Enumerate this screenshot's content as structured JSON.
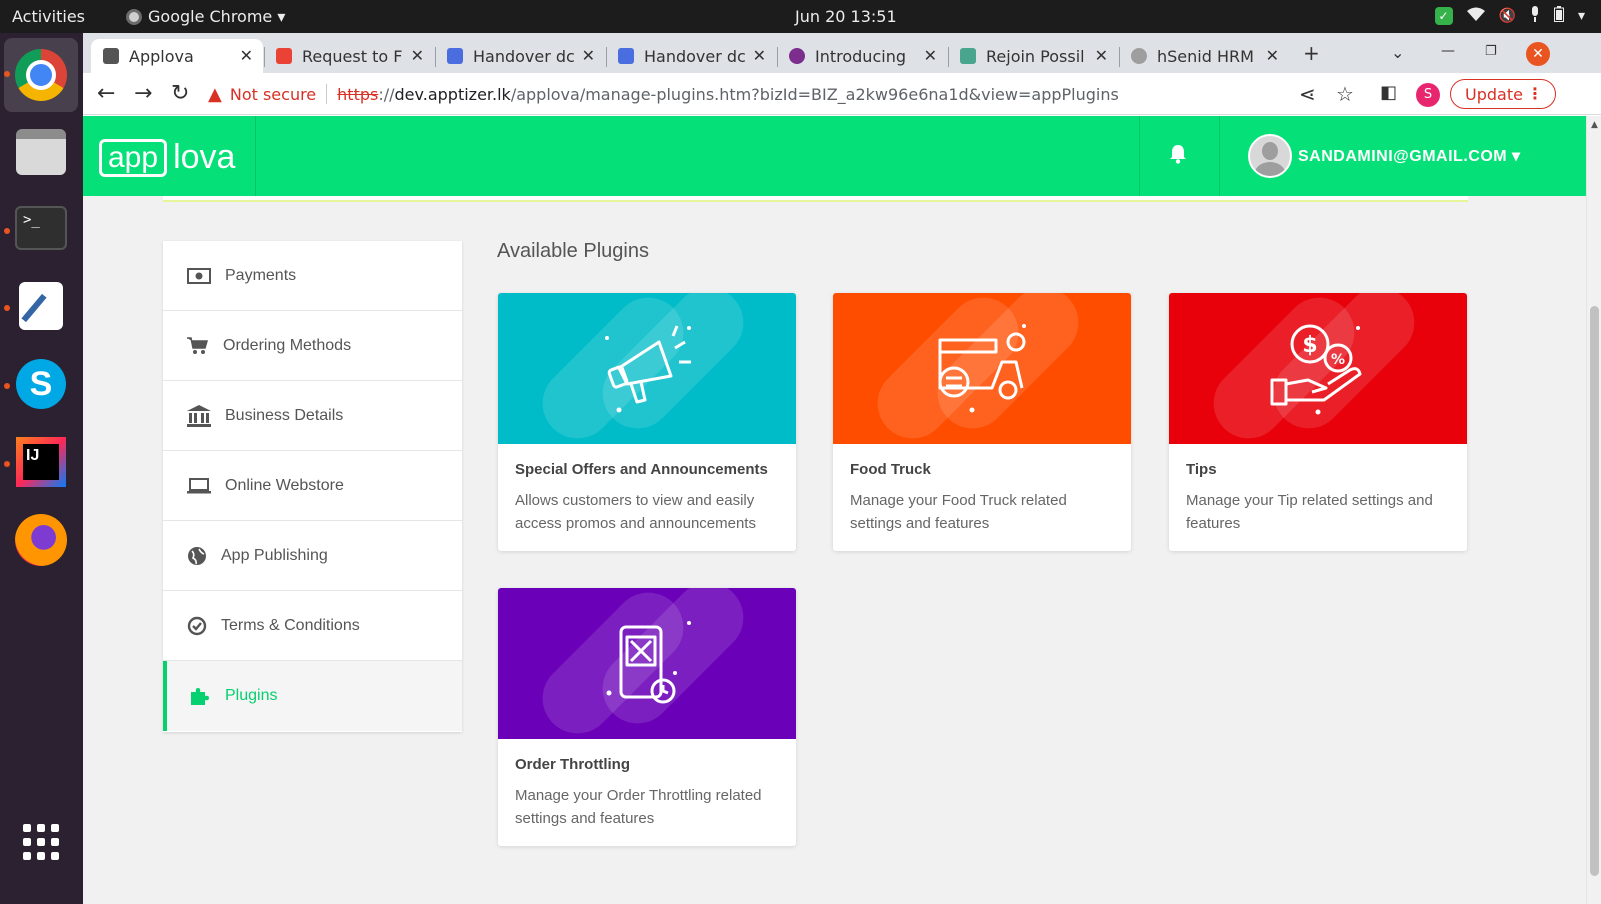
{
  "os": {
    "activities": "Activities",
    "app_menu": "Google Chrome ▾",
    "clock": "Jun 20  13:51"
  },
  "browser": {
    "tabs": [
      {
        "title": "Applova",
        "favicon_color": "#555555"
      },
      {
        "title": "Request to F",
        "favicon_color": "#ea4335"
      },
      {
        "title": "Handover dc",
        "favicon_color": "#4a6ee0"
      },
      {
        "title": "Handover dc",
        "favicon_color": "#4a6ee0"
      },
      {
        "title": "Introducing",
        "favicon_color": "#7b2e8c"
      },
      {
        "title": "Rejoin Possil",
        "favicon_color": "#4aa58e"
      },
      {
        "title": "hSenid HRM",
        "favicon_color": "#9e9e9e"
      }
    ],
    "new_tab": "+",
    "security_label": "Not secure",
    "url_scheme": "https",
    "url_host": "dev.apptizer.lk",
    "url_path": "/applova/manage-plugins.htm?bizId=BIZ_a2kw96e6na1d&view=appPlugins",
    "profile_initial": "S",
    "update_label": "Update"
  },
  "app": {
    "logo_box": "app",
    "logo_rest": "lova",
    "user_email": "SANDAMINI@GMAIL.COM",
    "brand_color": "#06e078",
    "sidebar": [
      {
        "label": "Payments",
        "icon": "money-icon"
      },
      {
        "label": "Ordering Methods",
        "icon": "cart-icon"
      },
      {
        "label": "Business Details",
        "icon": "bank-icon"
      },
      {
        "label": "Online Webstore",
        "icon": "laptop-icon"
      },
      {
        "label": "App Publishing",
        "icon": "globe-icon"
      },
      {
        "label": "Terms & Conditions",
        "icon": "check-circle-icon"
      },
      {
        "label": "Plugins",
        "icon": "puzzle-icon",
        "active": true
      }
    ],
    "section_title": "Available Plugins",
    "plugins": [
      {
        "title": "Special Offers and Announcements",
        "description": "Allows customers to view and easily access promos and announcements",
        "color": "#00bcc8",
        "icon": "megaphone-icon"
      },
      {
        "title": "Food Truck",
        "description": "Manage your Food Truck related settings and features",
        "color": "#ff4d00",
        "icon": "food-truck-icon"
      },
      {
        "title": "Tips",
        "description": "Manage your Tip related settings and features",
        "color": "#e8000b",
        "icon": "tip-hand-icon"
      },
      {
        "title": "Order Throttling",
        "description": "Manage your Order Throttling related settings and features",
        "color": "#6a00b8",
        "icon": "order-throttle-icon"
      }
    ]
  }
}
